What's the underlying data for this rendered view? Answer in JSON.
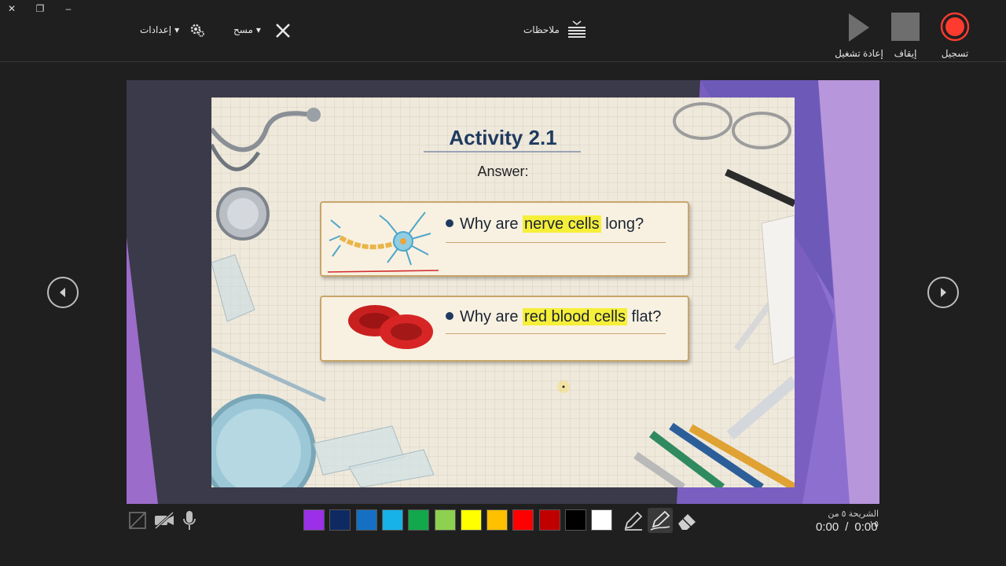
{
  "window": {
    "close_glyph": "✕",
    "restore_glyph": "❐",
    "minimize_glyph": "–"
  },
  "toolbar": {
    "settings_label": "إعدادات",
    "clear_label": "مسح",
    "notes_label": "ملاحظات",
    "replay_label": "إعادة تشغيل",
    "stop_label": "إيقاف",
    "record_label": "تسجيل",
    "dropdown_glyph": "▾"
  },
  "slide": {
    "title": "Activity 2.1",
    "subtitle": "Answer:",
    "q1_pre": "Why are ",
    "q1_highlight": "nerve cells",
    "q1_post": " long?",
    "q2_pre": "Why are ",
    "q2_highlight": "red blood cells",
    "q2_post": " flat?"
  },
  "colors": {
    "pen_swatches": [
      "#9b30e8",
      "#0f2a63",
      "#1570c4",
      "#17b2e8",
      "#13a84b",
      "#8ed14f",
      "#ffff00",
      "#ffc000",
      "#ff0000",
      "#c00000",
      "#000000",
      "#ffffff"
    ],
    "record_red": "#ff3b30",
    "accent_purple": "#8f63c9"
  },
  "status": {
    "slide_counter": "الشريحة ٥ من ١٥",
    "elapsed": "0:00",
    "separator": "/",
    "total": "0:00"
  },
  "icons": {
    "settings": "gear-icon",
    "clear": "close-icon",
    "notes": "notes-icon",
    "replay": "play-icon",
    "stop": "stop-icon",
    "record": "record-icon",
    "prev": "chevron-left-icon",
    "next": "chevron-right-icon",
    "camera_preview": "camera-preview-off-icon",
    "camera": "camera-off-icon",
    "microphone": "microphone-icon",
    "pen": "pen-icon",
    "highlighter": "highlighter-icon",
    "eraser": "eraser-icon"
  }
}
